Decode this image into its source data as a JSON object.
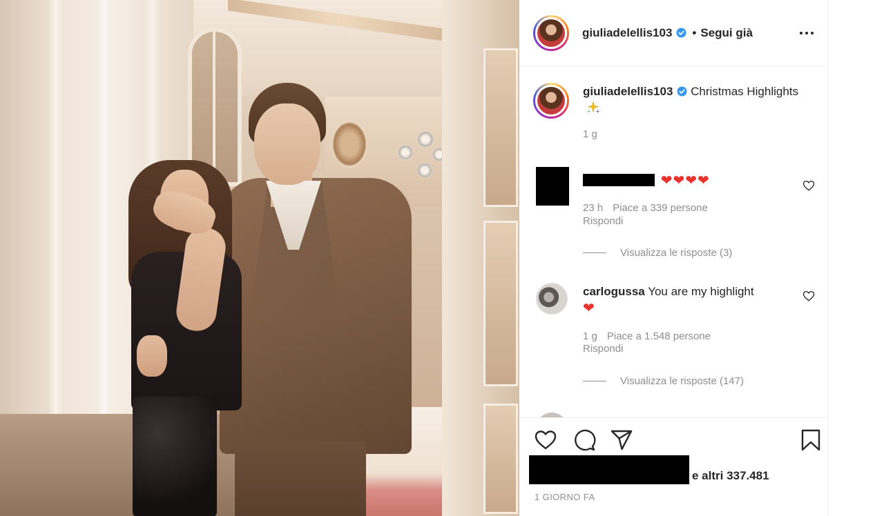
{
  "post": {
    "author": "giuliadelellis103",
    "verified": true,
    "follow_separator": "•",
    "follow_status": "Segui già",
    "caption_text": "Christmas Highlights",
    "caption_emoji": "sparkles",
    "caption_time": "1 g"
  },
  "comments": [
    {
      "username": "",
      "username_redacted": true,
      "text_emoji": "❤❤❤❤",
      "time": "23 h",
      "likes": "Piace a 339 persone",
      "reply_label": "Rispondi",
      "view_replies": "Visualizza le risposte (3)"
    },
    {
      "username": "carlogussa",
      "text": "You are my highlight",
      "text_emoji": "❤",
      "time": "1 g",
      "likes": "Piace a 1.548 persone",
      "reply_label": "Rispondi",
      "view_replies": "Visualizza le risposte (147)"
    }
  ],
  "footer": {
    "likes_suffix": "e altri 337.481",
    "date": "1 GIORNO FA"
  },
  "icons": {
    "more": "more-options-icon",
    "like": "heart-outline-icon",
    "comment": "comment-bubble-icon",
    "share": "paper-plane-icon",
    "save": "bookmark-icon"
  },
  "colors": {
    "text": "#262626",
    "muted": "#8e8e8e",
    "verified_blue": "#3897f0",
    "heart_red": "#e8322c",
    "divider": "#efefef"
  }
}
